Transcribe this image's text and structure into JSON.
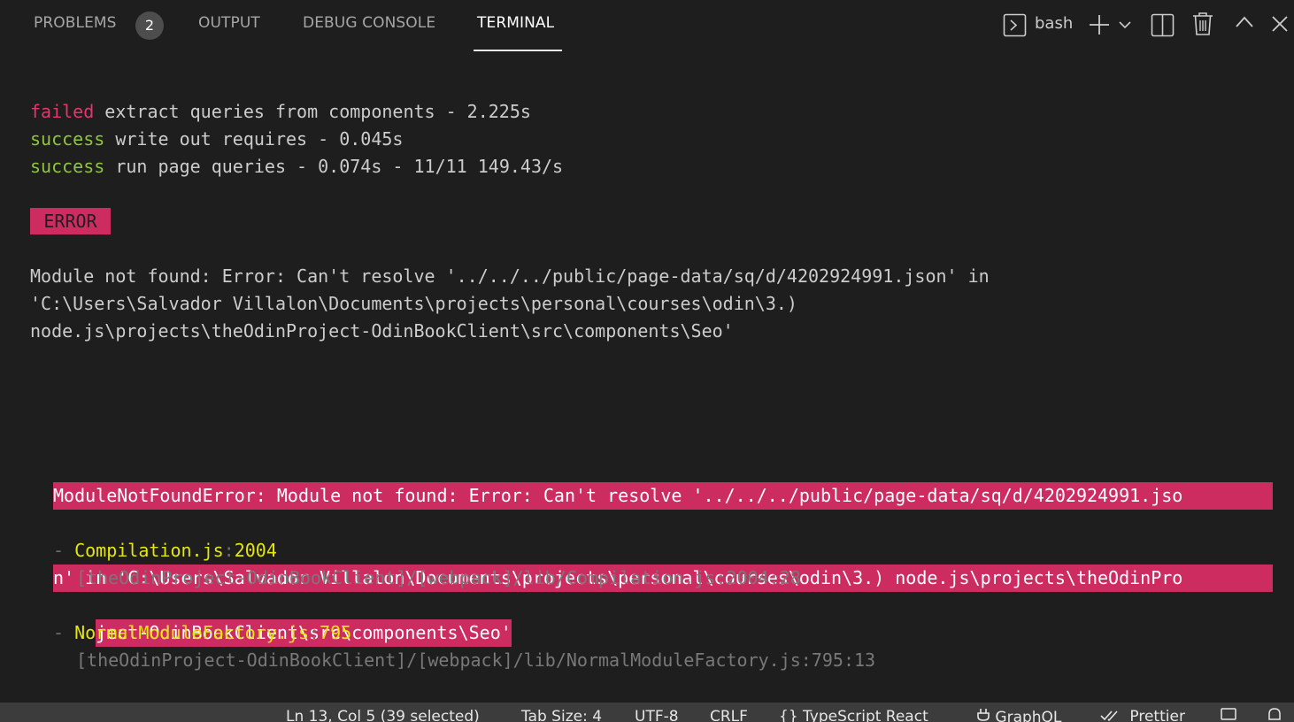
{
  "panel": {
    "tabs": [
      {
        "label": "PROBLEMS",
        "badge": "2"
      },
      {
        "label": "OUTPUT"
      },
      {
        "label": "DEBUG CONSOLE"
      },
      {
        "label": "TERMINAL",
        "active": true
      }
    ],
    "shell_name": "bash",
    "icons": [
      "terminal-icon",
      "plus-icon",
      "chevron-down-icon",
      "split-icon",
      "trash-icon",
      "chevron-up-icon",
      "close-icon"
    ]
  },
  "terminal": {
    "lines": [
      {
        "status": "failed",
        "message": " extract queries from components - 2.225s"
      },
      {
        "status": "success",
        "message": " write out requires - 0.045s"
      },
      {
        "status": "success",
        "message": " run page queries - 0.074s - 11/11 149.43/s"
      }
    ],
    "error_badge": "ERROR",
    "module_error": [
      "Module not found: Error: Can't resolve '../../../public/page-data/sq/d/4202924991.json' in",
      "'C:\\Users\\Salvador Villalon\\Documents\\projects\\personal\\courses\\odin\\3.)",
      "node.js\\projects\\theOdinProject-OdinBookClient\\src\\components\\Seo'"
    ],
    "highlighted_error": [
      "ModuleNotFoundError: Module not found: Error: Can't resolve '../../../public/page-data/sq/d/4202924991.jso",
      "n' in 'C:\\Users\\Salvador Villalon\\Documents\\projects\\personal\\courses\\odin\\3.) node.js\\projects\\theOdinPro",
      "ject-OdinBookClient\\src\\components\\Seo'"
    ],
    "stack": [
      {
        "dash": "- ",
        "file": "Compilation.js",
        "sep": ":",
        "line": "2004",
        "path": "[theOdinProject-OdinBookClient]/[webpack]/lib/Compilation.js:2004:28"
      },
      {
        "dash": "- ",
        "file": "NormalModuleFactory.js",
        "sep": ":",
        "line": "795",
        "path": "[theOdinProject-OdinBookClient]/[webpack]/lib/NormalModuleFactory.js:795:13"
      }
    ]
  },
  "statusbar": {
    "cursor": "Ln 13, Col 5 (39 selected)",
    "tab_size": "Tab Size: 4",
    "encoding": "UTF-8",
    "eol": "CRLF",
    "language": "TypeScript React",
    "graphql": "GraphQL",
    "prettier": "Prettier"
  },
  "colors": {
    "background": "#1e1e1e",
    "failed": "#e5366b",
    "success": "#8fc53e",
    "error_highlight": "#cd2c61",
    "stack_file": "#e5e510",
    "statusbar": "#3c3c3c"
  }
}
